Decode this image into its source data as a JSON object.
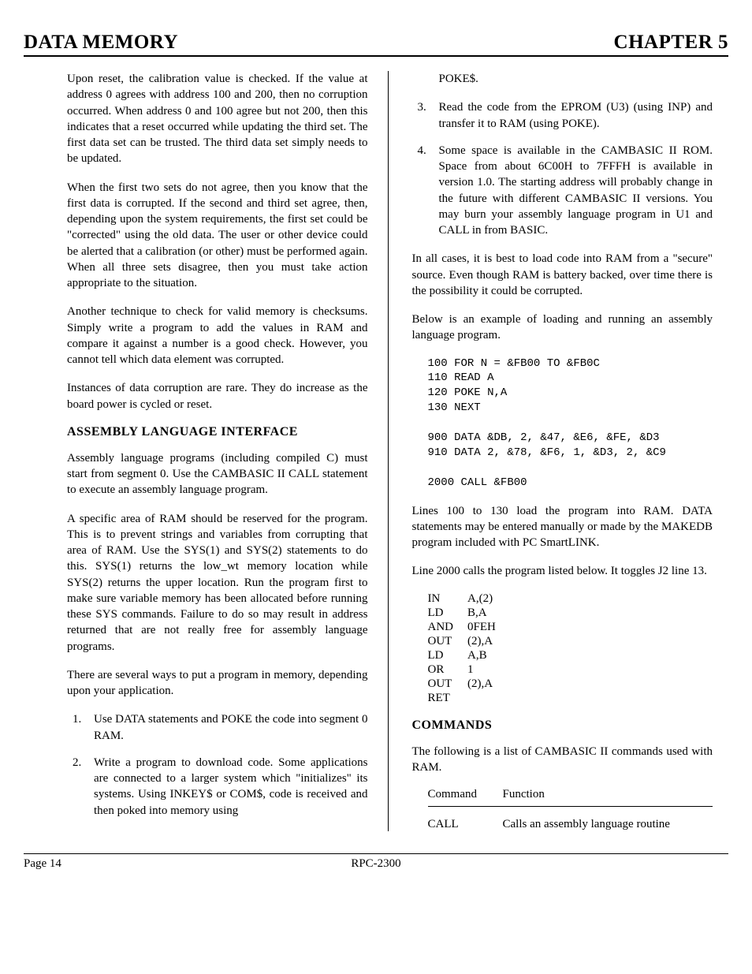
{
  "header": {
    "left": "DATA MEMORY",
    "right": "CHAPTER 5"
  },
  "left": {
    "p1": "Upon reset, the calibration value is checked.  If the value at address 0 agrees with address 100 and 200, then no corruption occurred.  When address 0 and 100 agree but not 200, then this indicates that a reset occurred while updating the third set.  The first data set can be trusted.  The third data set simply needs to be updated.",
    "p2": "When the first two sets do not agree, then you know that the first data is corrupted.  If the second and third set agree, then, depending upon the system requirements, the first set could be \"corrected\" using the old data.  The user or other device could be alerted that a calibration (or other) must be performed again.  When all three sets disagree, then you must take action appropriate to the situation.",
    "p3": "Another technique to check for valid memory is checksums.  Simply write a program to add the values in RAM and compare it against a number is a good check.  However, you cannot tell which data element was corrupted.",
    "p4": "Instances of data corruption are rare.  They do increase as the board power is cycled or reset.",
    "h2a": "ASSEMBLY LANGUAGE INTERFACE",
    "p5": "Assembly language programs (including compiled C) must start from segment 0.  Use the CAMBASIC II CALL statement to execute an assembly language program.",
    "p6": "A specific area of RAM should be reserved for the program.  This is to prevent strings and variables from corrupting that area of RAM.  Use the SYS(1) and SYS(2) statements to do this.  SYS(1) returns the low_wt memory location while SYS(2) returns the upper location.  Run the program first to make sure variable memory has been allocated before running these SYS commands.  Failure to do so may result in address returned that are not really free for assembly language programs.",
    "p7": "There are several ways to put a program in memory, depending upon your application.",
    "li1": "Use DATA statements and POKE the code into segment 0 RAM.",
    "li2": "Write a program to download code.  Some applications are connected to a larger system which \"initializes\" its systems.  Using INKEY$ or COM$, code is received and then poked into memory using"
  },
  "right": {
    "orphan": "POKE$.",
    "li3": "Read the code from the EPROM (U3) (using INP) and transfer it to RAM (using POKE).",
    "li4": "Some space is available in the CAMBASIC II ROM.  Space from about 6C00H to 7FFFH is available in version 1.0.  The starting address will probably change in the future with different CAMBASIC II versions.  You may burn your assembly language program in U1 and CALL in from BASIC.",
    "p8": "In all cases, it is best to load code into RAM from a \"secure\" source.  Even though RAM is battery backed, over time there is the possibility it could be corrupted.",
    "p9": "Below is an example of loading and running an assembly language program.",
    "code": "100 FOR N = &FB00 TO &FB0C\n110 READ A\n120 POKE N,A\n130 NEXT\n\n900 DATA &DB, 2, &47, &E6, &FE, &D3\n910 DATA 2, &78, &F6, 1, &D3, 2, &C9\n\n2000 CALL &FB00",
    "p10": "Lines 100 to 130 load the program into RAM.  DATA statements may be entered manually or made by the MAKEDB program included with PC SmartLINK.",
    "p11": "Line 2000 calls the program listed below.  It toggles J2 line 13.",
    "asm": [
      [
        "IN",
        "A,(2)"
      ],
      [
        "LD",
        "B,A"
      ],
      [
        "AND",
        "0FEH"
      ],
      [
        "OUT",
        "(2),A"
      ],
      [
        "LD",
        "A,B"
      ],
      [
        "OR",
        "1"
      ],
      [
        "OUT",
        "(2),A"
      ],
      [
        "RET",
        ""
      ]
    ],
    "h2b": "COMMANDS",
    "p12": "The following is a list of CAMBASIC II commands used with RAM.",
    "th1": "Command",
    "th2": "Function",
    "cmd1": "CALL",
    "fn1": "Calls an assembly language routine"
  },
  "footer": {
    "left": "Page 14",
    "center": "RPC-2300"
  }
}
